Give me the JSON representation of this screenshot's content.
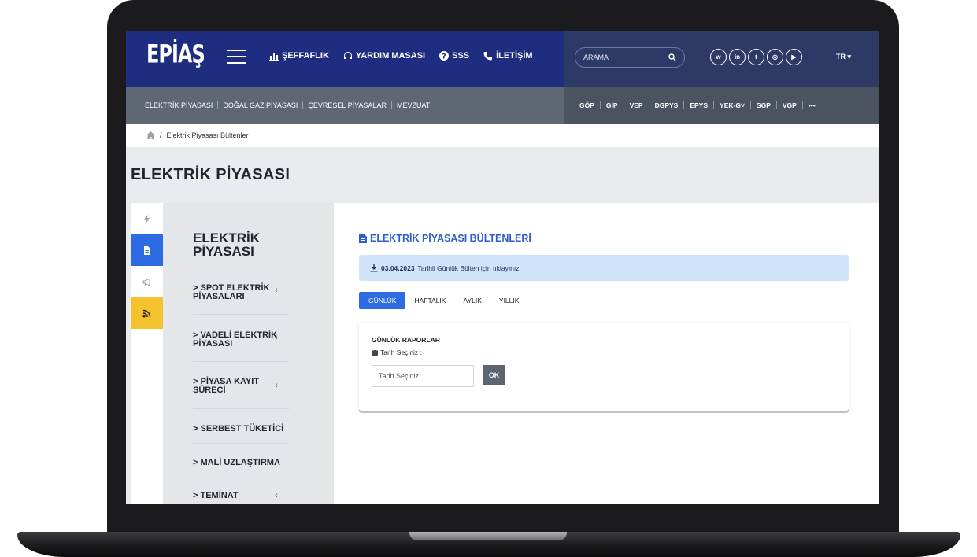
{
  "header": {
    "logo": "EPİAŞ",
    "nav": [
      {
        "label": "ŞEFFAFLIK",
        "icon": "chart-icon"
      },
      {
        "label": "YARDIM MASASI",
        "icon": "headset-icon"
      },
      {
        "label": "SSS",
        "icon": "question-icon"
      },
      {
        "label": "İLETİŞİM",
        "icon": "phone-icon"
      }
    ],
    "search_placeholder": "ARAMA",
    "socials": [
      {
        "name": "web",
        "label": "w"
      },
      {
        "name": "linkedin",
        "label": "in"
      },
      {
        "name": "twitter",
        "label": "t"
      },
      {
        "name": "instagram",
        "label": "◎"
      },
      {
        "name": "youtube",
        "label": "▶"
      }
    ],
    "language": "TR ▾"
  },
  "subnav": {
    "left": [
      "ELEKTRİK PİYASASI",
      "DOĞAL GAZ PİYASASI",
      "ÇEVRESEL PİYASALAR",
      "MEVZUAT"
    ],
    "right": [
      "GÖP",
      "GİP",
      "VEP",
      "DGPYS",
      "EPYS",
      "YEK-G˅",
      "SGP",
      "VGP",
      "•••"
    ]
  },
  "breadcrumb": {
    "current": "Elektrik Piyasası Bültenler"
  },
  "page_title": "ELEKTRİK PİYASASI",
  "rail": [
    "bolt-icon",
    "document-icon",
    "megaphone-icon",
    "rss-icon"
  ],
  "sidebar": {
    "title": "ELEKTRİK PİYASASI",
    "items": [
      {
        "label": "> SPOT ELEKTRİK PİYASALARI",
        "chev": "‹"
      },
      {
        "label": "> VADELİ ELEKTRİK PİYASASI",
        "chev": "‹"
      },
      {
        "label": "> PİYASA KAYIT SÜRECİ",
        "chev": "‹"
      },
      {
        "label": "> SERBEST TÜKETİCİ",
        "chev": ""
      },
      {
        "label": "> MALİ UZLAŞTIRMA",
        "chev": ""
      },
      {
        "label": "> TEMİNAT",
        "chev": "‹"
      }
    ]
  },
  "main": {
    "title": "ELEKTRİK PİYASASI BÜLTENLERİ",
    "info_date": "03.04.2023",
    "info_text": "Tarihli Günlük Bülten için tıklayınız.",
    "tabs": [
      "GÜNLÜK",
      "HAFTALIK",
      "AYLIK",
      "YILLIK"
    ],
    "active_tab": "GÜNLÜK",
    "report": {
      "title": "GÜNLÜK RAPORLAR",
      "date_label": "Tarih Seçiniz :",
      "date_placeholder": "Tarih Seçiniz",
      "ok": "OK"
    }
  },
  "colors": {
    "header_blue": "#1f2d80",
    "accent_blue": "#2d6be3",
    "rss_yellow": "#f4c12f"
  }
}
